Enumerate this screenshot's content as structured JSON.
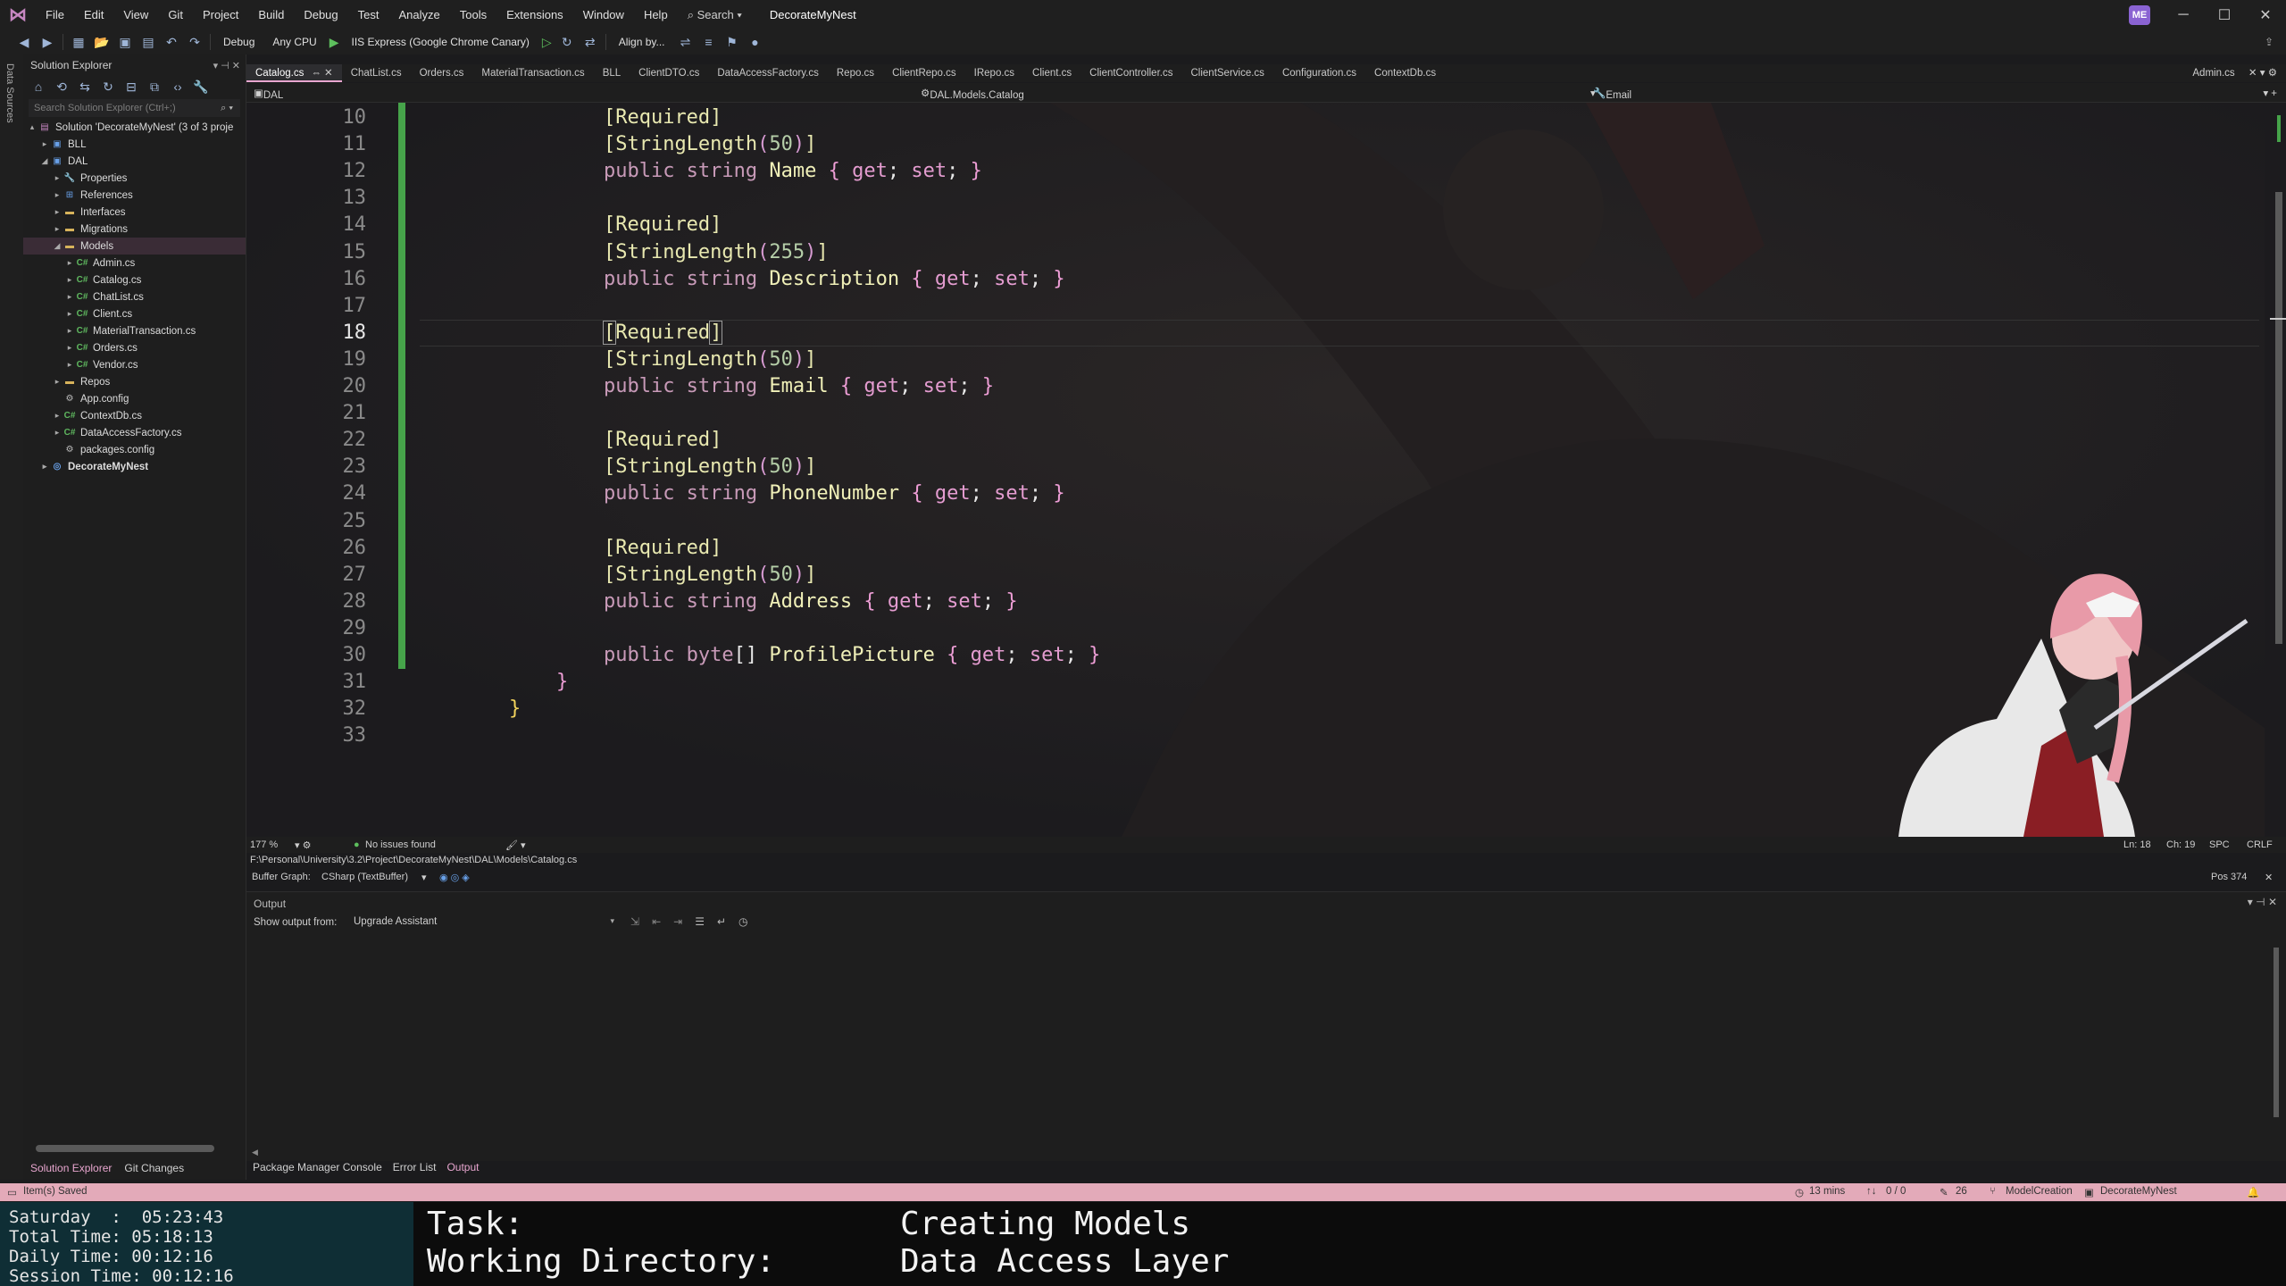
{
  "titlebar": {
    "menu": [
      "File",
      "Edit",
      "View",
      "Git",
      "Project",
      "Build",
      "Debug",
      "Test",
      "Analyze",
      "Tools",
      "Extensions",
      "Window",
      "Help"
    ],
    "search_label": "Search",
    "solution_name": "DecorateMyNest",
    "avatar": "ME"
  },
  "toolbar": {
    "config": "Debug",
    "platform": "Any CPU",
    "run_target": "IIS Express (Google Chrome Canary)",
    "align_label": "Align by..."
  },
  "left_strip": {
    "label": "Data Sources"
  },
  "solution_explorer": {
    "title": "Solution Explorer",
    "search_placeholder": "Search Solution Explorer (Ctrl+;)",
    "tree": [
      {
        "label": "Solution 'DecorateMyNest' (3 of 3 proje",
        "icon": "solution-icon",
        "level": 0,
        "arrow": "▴"
      },
      {
        "label": "BLL",
        "icon": "project-icon",
        "level": 1,
        "arrow": "▸"
      },
      {
        "label": "DAL",
        "icon": "project-icon",
        "level": 1,
        "arrow": "◢"
      },
      {
        "label": "Properties",
        "icon": "wrench-icon",
        "level": 2,
        "arrow": "▸"
      },
      {
        "label": "References",
        "icon": "references-icon",
        "level": 2,
        "arrow": "▸"
      },
      {
        "label": "Interfaces",
        "icon": "folder-icon",
        "level": 2,
        "arrow": "▸"
      },
      {
        "label": "Migrations",
        "icon": "folder-icon",
        "level": 2,
        "arrow": "▸"
      },
      {
        "label": "Models",
        "icon": "folder-icon",
        "level": 2,
        "arrow": "◢",
        "selected": true
      },
      {
        "label": "Admin.cs",
        "icon": "csharp-file-icon",
        "level": 3,
        "arrow": "▸"
      },
      {
        "label": "Catalog.cs",
        "icon": "csharp-file-icon",
        "level": 3,
        "arrow": "▸"
      },
      {
        "label": "ChatList.cs",
        "icon": "csharp-file-icon",
        "level": 3,
        "arrow": "▸"
      },
      {
        "label": "Client.cs",
        "icon": "csharp-file-icon",
        "level": 3,
        "arrow": "▸"
      },
      {
        "label": "MaterialTransaction.cs",
        "icon": "csharp-file-icon",
        "level": 3,
        "arrow": "▸"
      },
      {
        "label": "Orders.cs",
        "icon": "csharp-file-icon",
        "level": 3,
        "arrow": "▸"
      },
      {
        "label": "Vendor.cs",
        "icon": "csharp-file-icon",
        "level": 3,
        "arrow": "▸"
      },
      {
        "label": "Repos",
        "icon": "folder-icon",
        "level": 2,
        "arrow": "▸"
      },
      {
        "label": "App.config",
        "icon": "config-file-icon",
        "level": 2,
        "arrow": ""
      },
      {
        "label": "ContextDb.cs",
        "icon": "csharp-file-icon",
        "level": 2,
        "arrow": "▸"
      },
      {
        "label": "DataAccessFactory.cs",
        "icon": "csharp-file-icon",
        "level": 2,
        "arrow": "▸"
      },
      {
        "label": "packages.config",
        "icon": "config-file-icon",
        "level": 2,
        "arrow": ""
      },
      {
        "label": "DecorateMyNest",
        "icon": "web-project-icon",
        "level": 1,
        "arrow": "▸",
        "bold": true
      }
    ],
    "bottom_tabs": [
      "Solution Explorer",
      "Git Changes"
    ]
  },
  "editor_tabs": {
    "tabs": [
      "Catalog.cs",
      "ChatList.cs",
      "Orders.cs",
      "MaterialTransaction.cs",
      "BLL",
      "ClientDTO.cs",
      "DataAccessFactory.cs",
      "Repo.cs",
      "ClientRepo.cs",
      "IRepo.cs",
      "Client.cs",
      "ClientController.cs",
      "ClientService.cs",
      "Configuration.cs",
      "ContextDb.cs"
    ],
    "active_index": 0,
    "right_tab": "Admin.cs"
  },
  "navbar": {
    "project": "DAL",
    "type": "DAL.Models.Catalog",
    "member": "Email"
  },
  "editor": {
    "current_line": 18,
    "lines": [
      {
        "no": "10",
        "code": [
          {
            "t": "        ",
            "c": "tok-punc"
          },
          {
            "t": "[Required]",
            "c": "tok-attr"
          }
        ]
      },
      {
        "no": "11",
        "code": [
          {
            "t": "        ",
            "c": "tok-punc"
          },
          {
            "t": "[StringLength",
            "c": "tok-attr"
          },
          {
            "t": "(",
            "c": "tok-paren"
          },
          {
            "t": "50",
            "c": "tok-num"
          },
          {
            "t": ")",
            "c": "tok-paren"
          },
          {
            "t": "]",
            "c": "tok-attr"
          }
        ]
      },
      {
        "no": "12",
        "code": [
          {
            "t": "        ",
            "c": "tok-punc"
          },
          {
            "t": "public string ",
            "c": "tok-kw"
          },
          {
            "t": "Name ",
            "c": "tok-ident"
          },
          {
            "t": "{ ",
            "c": "tok-brace"
          },
          {
            "t": "get",
            "c": "tok-accessor"
          },
          {
            "t": "; ",
            "c": "tok-punc"
          },
          {
            "t": "set",
            "c": "tok-accessor"
          },
          {
            "t": "; ",
            "c": "tok-punc"
          },
          {
            "t": "}",
            "c": "tok-brace"
          }
        ]
      },
      {
        "no": "13",
        "code": []
      },
      {
        "no": "14",
        "code": [
          {
            "t": "        ",
            "c": "tok-punc"
          },
          {
            "t": "[Required]",
            "c": "tok-attr"
          }
        ]
      },
      {
        "no": "15",
        "code": [
          {
            "t": "        ",
            "c": "tok-punc"
          },
          {
            "t": "[StringLength",
            "c": "tok-attr"
          },
          {
            "t": "(",
            "c": "tok-paren"
          },
          {
            "t": "255",
            "c": "tok-num"
          },
          {
            "t": ")",
            "c": "tok-paren"
          },
          {
            "t": "]",
            "c": "tok-attr"
          }
        ]
      },
      {
        "no": "16",
        "code": [
          {
            "t": "        ",
            "c": "tok-punc"
          },
          {
            "t": "public string ",
            "c": "tok-kw"
          },
          {
            "t": "Description ",
            "c": "tok-ident"
          },
          {
            "t": "{ ",
            "c": "tok-brace"
          },
          {
            "t": "get",
            "c": "tok-accessor"
          },
          {
            "t": "; ",
            "c": "tok-punc"
          },
          {
            "t": "set",
            "c": "tok-accessor"
          },
          {
            "t": "; ",
            "c": "tok-punc"
          },
          {
            "t": "}",
            "c": "tok-brace"
          }
        ]
      },
      {
        "no": "17",
        "code": []
      },
      {
        "no": "18",
        "code": [
          {
            "t": "        ",
            "c": "tok-punc"
          },
          {
            "t": "[",
            "c": "tok-attr bracket-box"
          },
          {
            "t": "Required",
            "c": "tok-attr"
          },
          {
            "t": "]",
            "c": "tok-attr bracket-box"
          }
        ]
      },
      {
        "no": "19",
        "code": [
          {
            "t": "        ",
            "c": "tok-punc"
          },
          {
            "t": "[StringLength",
            "c": "tok-attr"
          },
          {
            "t": "(",
            "c": "tok-paren"
          },
          {
            "t": "50",
            "c": "tok-num"
          },
          {
            "t": ")",
            "c": "tok-paren"
          },
          {
            "t": "]",
            "c": "tok-attr"
          }
        ]
      },
      {
        "no": "20",
        "code": [
          {
            "t": "        ",
            "c": "tok-punc"
          },
          {
            "t": "public string ",
            "c": "tok-kw"
          },
          {
            "t": "Email ",
            "c": "tok-ident"
          },
          {
            "t": "{ ",
            "c": "tok-brace"
          },
          {
            "t": "get",
            "c": "tok-accessor"
          },
          {
            "t": "; ",
            "c": "tok-punc"
          },
          {
            "t": "set",
            "c": "tok-accessor"
          },
          {
            "t": "; ",
            "c": "tok-punc"
          },
          {
            "t": "}",
            "c": "tok-brace"
          }
        ]
      },
      {
        "no": "21",
        "code": []
      },
      {
        "no": "22",
        "code": [
          {
            "t": "        ",
            "c": "tok-punc"
          },
          {
            "t": "[Required]",
            "c": "tok-attr"
          }
        ]
      },
      {
        "no": "23",
        "code": [
          {
            "t": "        ",
            "c": "tok-punc"
          },
          {
            "t": "[StringLength",
            "c": "tok-attr"
          },
          {
            "t": "(",
            "c": "tok-paren"
          },
          {
            "t": "50",
            "c": "tok-num"
          },
          {
            "t": ")",
            "c": "tok-paren"
          },
          {
            "t": "]",
            "c": "tok-attr"
          }
        ]
      },
      {
        "no": "24",
        "code": [
          {
            "t": "        ",
            "c": "tok-punc"
          },
          {
            "t": "public string ",
            "c": "tok-kw"
          },
          {
            "t": "PhoneNumber ",
            "c": "tok-ident"
          },
          {
            "t": "{ ",
            "c": "tok-brace"
          },
          {
            "t": "get",
            "c": "tok-accessor"
          },
          {
            "t": "; ",
            "c": "tok-punc"
          },
          {
            "t": "set",
            "c": "tok-accessor"
          },
          {
            "t": "; ",
            "c": "tok-punc"
          },
          {
            "t": "}",
            "c": "tok-brace"
          }
        ]
      },
      {
        "no": "25",
        "code": []
      },
      {
        "no": "26",
        "code": [
          {
            "t": "        ",
            "c": "tok-punc"
          },
          {
            "t": "[Required]",
            "c": "tok-attr"
          }
        ]
      },
      {
        "no": "27",
        "code": [
          {
            "t": "        ",
            "c": "tok-punc"
          },
          {
            "t": "[StringLength",
            "c": "tok-attr"
          },
          {
            "t": "(",
            "c": "tok-paren"
          },
          {
            "t": "50",
            "c": "tok-num"
          },
          {
            "t": ")",
            "c": "tok-paren"
          },
          {
            "t": "]",
            "c": "tok-attr"
          }
        ]
      },
      {
        "no": "28",
        "code": [
          {
            "t": "        ",
            "c": "tok-punc"
          },
          {
            "t": "public string ",
            "c": "tok-kw"
          },
          {
            "t": "Address ",
            "c": "tok-ident"
          },
          {
            "t": "{ ",
            "c": "tok-brace"
          },
          {
            "t": "get",
            "c": "tok-accessor"
          },
          {
            "t": "; ",
            "c": "tok-punc"
          },
          {
            "t": "set",
            "c": "tok-accessor"
          },
          {
            "t": "; ",
            "c": "tok-punc"
          },
          {
            "t": "}",
            "c": "tok-brace"
          }
        ]
      },
      {
        "no": "29",
        "code": []
      },
      {
        "no": "30",
        "code": [
          {
            "t": "        ",
            "c": "tok-punc"
          },
          {
            "t": "public byte",
            "c": "tok-kw"
          },
          {
            "t": "[] ",
            "c": "tok-punc"
          },
          {
            "t": "ProfilePicture ",
            "c": "tok-ident"
          },
          {
            "t": "{ ",
            "c": "tok-brace"
          },
          {
            "t": "get",
            "c": "tok-accessor"
          },
          {
            "t": "; ",
            "c": "tok-punc"
          },
          {
            "t": "set",
            "c": "tok-accessor"
          },
          {
            "t": "; ",
            "c": "tok-punc"
          },
          {
            "t": "}",
            "c": "tok-brace"
          }
        ]
      },
      {
        "no": "31",
        "code": [
          {
            "t": "    ",
            "c": "tok-punc"
          },
          {
            "t": "}",
            "c": "tok-brace"
          }
        ]
      },
      {
        "no": "32",
        "code": [
          {
            "t": "}",
            "c": "tok-brace2"
          }
        ]
      },
      {
        "no": "33",
        "code": []
      }
    ]
  },
  "editor_status": {
    "zoom": "177 %",
    "issues": "No issues found",
    "ln": "Ln: 18",
    "ch": "Ch: 19",
    "spc": "SPC",
    "eol": "CRLF"
  },
  "path": "F:\\Personal\\University\\3.2\\Project\\DecorateMyNest\\DAL\\Models\\Catalog.cs",
  "buffer": {
    "label": "Buffer Graph:",
    "value": "CSharp (TextBuffer)",
    "pos": "Pos 374"
  },
  "output": {
    "title": "Output",
    "from_label": "Show output from:",
    "source": "Upgrade Assistant"
  },
  "panel_tabs": [
    "Package Manager Console",
    "Error List",
    "Output"
  ],
  "statusbar": {
    "message": "Item(s) Saved",
    "time": "13 mins",
    "sync": "0 / 0",
    "pencil": "26",
    "branch": "ModelCreation",
    "repo": "DecorateMyNest"
  },
  "overlay": {
    "times": [
      "Saturday  :  05:23:43",
      "Total Time: 05:18:13",
      "Daily Time: 00:12:16",
      "Session Time: 00:12:16"
    ],
    "task_label": "Task:",
    "task_value": "Creating Models",
    "dir_label": "Working Directory:",
    "dir_value": "Data Access Layer"
  },
  "colors": {
    "accent": "#e8a6cf",
    "statusbar": "#e3aab9",
    "change_bar": "#46a34a",
    "time_panel": "#0f2e35"
  }
}
